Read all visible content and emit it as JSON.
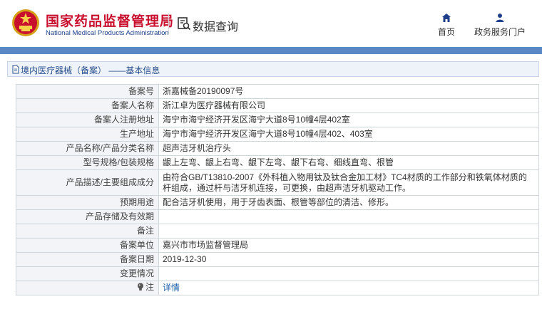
{
  "header": {
    "org_name_cn": "国家药品监督管理局",
    "org_name_en": "National Medical Products Administration",
    "query_label": "数据查询",
    "nav": [
      {
        "label": "首页",
        "icon": "home-icon"
      },
      {
        "label": "政务服务门户",
        "icon": "person-icon"
      }
    ]
  },
  "breadcrumb": {
    "text": "境内医疗器械（备案） ——基本信息",
    "icon": "document-icon"
  },
  "record": {
    "rows": [
      {
        "label": "备案号",
        "value": "浙嘉械备20190097号"
      },
      {
        "label": "备案人名称",
        "value": "浙江卓为医疗器械有限公司"
      },
      {
        "label": "备案人注册地址",
        "value": "海宁市海宁经济开发区海宁大道8号10幢4层402室"
      },
      {
        "label": "生产地址",
        "value": "海宁市海宁经济开发区海宁大道8号10幢4层402、403室"
      },
      {
        "label": "产品名称/产品分类名称",
        "value": "超声洁牙机治疗头"
      },
      {
        "label": "型号规格/包装规格",
        "value": "龈上左弯、龈上右弯、龈下左弯、龈下右弯、细线直弯、根管"
      },
      {
        "label": "产品描述/主要组成成分",
        "value": "由符合GB/T13810-2007《外科植入物用钛及钛合金加工材》TC4材质的工作部分和铁氧体材质的杆组成，通过杆与洁牙机连接，可更换，由超声洁牙机驱动工作。"
      },
      {
        "label": "预期用途",
        "value": "配合洁牙机使用，用于牙齿表面、根管等部位的清洁、修形。"
      },
      {
        "label": "产品存储及有效期",
        "value": ""
      },
      {
        "label": "备注",
        "value": ""
      },
      {
        "label": "备案单位",
        "value": "嘉兴市市场监督管理局"
      },
      {
        "label": "备案日期",
        "value": "2019-12-30"
      },
      {
        "label": "变更情况",
        "value": ""
      }
    ],
    "note": {
      "label": "注",
      "link_text": "详情",
      "icon": "lightbulb-icon"
    }
  },
  "colors": {
    "brand_red": "#c8102e",
    "brand_blue": "#1f3f8a",
    "topbar_blue": "#5a88c4",
    "link_blue": "#1f5fa8",
    "label_bg": "#f2f4f7"
  }
}
